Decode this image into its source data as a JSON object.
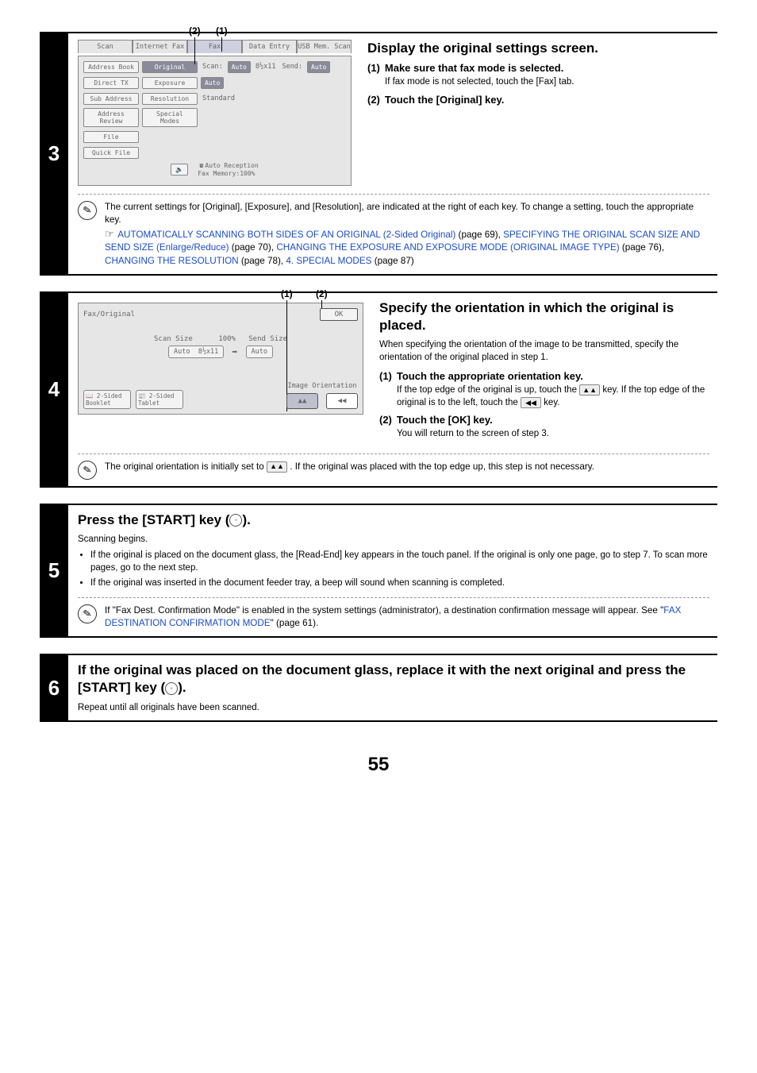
{
  "step3": {
    "num": "3",
    "anno1": "(2)",
    "anno2": "(1)",
    "tabs": {
      "scan": "Scan",
      "ifax": "Internet Fax",
      "fax": "Fax",
      "dataentry": "Data Entry",
      "usb": "USB Mem. Scan"
    },
    "left": {
      "addrbook": "Address Book",
      "directtx": "Direct TX",
      "subaddr": "Sub Address",
      "addrrev": "Address Review",
      "file": "File",
      "quick": "Quick File"
    },
    "mid": {
      "original": "Original",
      "exposure": "Exposure",
      "resolution": "Resolution",
      "special": "Special Modes"
    },
    "right": {
      "scanlbl": "Scan:",
      "auto": "Auto",
      "size": "8½x11",
      "sendlbl": "Send:",
      "auto2": "Auto",
      "expauto": "Auto",
      "resstd": "Standard"
    },
    "footer": {
      "autorec": "Auto Reception",
      "mem": "Fax Memory:100%",
      "phone": "☎"
    },
    "heading": "Display the original settings screen.",
    "item1_num": "(1)",
    "item1_bold": "Make sure that fax mode is selected.",
    "item1_desc": "If fax mode is not selected, touch the [Fax] tab.",
    "item2_num": "(2)",
    "item2_bold": "Touch the [Original] key.",
    "note_lead": "The current settings for [Original], [Exposure], and [Resolution], are indicated at the right of each key. To change a setting, touch the appropriate key.",
    "note_pointer": "☞",
    "note_link1": "AUTOMATICALLY SCANNING BOTH SIDES OF AN ORIGINAL (2-Sided Original)",
    "note_p1": " (page 69), ",
    "note_link2": "SPECIFYING THE ORIGINAL SCAN SIZE AND SEND SIZE (Enlarge/Reduce)",
    "note_p2": " (page 70), ",
    "note_link3": "CHANGING THE EXPOSURE AND EXPOSURE MODE (ORIGINAL IMAGE TYPE)",
    "note_p3": " (page 76), ",
    "note_link4": "CHANGING THE RESOLUTION",
    "note_p4": " (page 78), ",
    "note_link5": "4. SPECIAL MODES",
    "note_p5": " (page 87)"
  },
  "step4": {
    "num": "4",
    "anno1": "(1)",
    "anno2": "(2)",
    "panel": {
      "title": "Fax/Original",
      "ok": "OK",
      "scansize": "Scan Size",
      "pct": "100%",
      "sendsize": "Send Size",
      "auto": "Auto",
      "size": "8½x11",
      "arrow": "➡",
      "auto2": "Auto",
      "book": "2-Sided\nBooklet",
      "tablet": "2-Sided\nTablet",
      "orientlbl": "Image Orientation",
      "top": "▲▲",
      "left": "◀◀"
    },
    "heading": "Specify the orientation in which the original is placed.",
    "lead": "When specifying the orientation of the image to be transmitted, specify the orientation of the original placed in step 1.",
    "item1_num": "(1)",
    "item1_bold": "Touch the appropriate orientation key.",
    "item1_desc_a": "If the top edge of the original is up, touch the ",
    "item1_desc_b": " key. If the top edge of the original is to the left, touch the ",
    "item1_desc_c": " key.",
    "item2_num": "(2)",
    "item2_bold": "Touch the [OK] key.",
    "item2_desc": "You will return to the screen of step 3.",
    "note_a": "The original orientation is initially set to ",
    "note_b": " . If the original was placed with the top edge up, this step is not necessary."
  },
  "step5": {
    "num": "5",
    "heading_a": "Press the [START] key (",
    "heading_b": ").",
    "lead": "Scanning begins.",
    "b1": "If the original is placed on the document glass, the [Read-End] key appears in the touch panel. If the original is only one page, go to step 7. To scan more pages, go to the next step.",
    "b2": "If the original was inserted in the document feeder tray, a beep will sound when scanning is completed.",
    "note_a": "If \"Fax Dest. Confirmation Mode\" is enabled in the system settings (administrator), a destination confirmation message will appear. See \"",
    "note_link": "FAX DESTINATION CONFIRMATION MODE",
    "note_b": "\" (page 61)."
  },
  "step6": {
    "num": "6",
    "heading_a": "If the original was placed on the document glass, replace it with the next original and press the [START] key (",
    "heading_b": ").",
    "desc": "Repeat until all originals have been scanned."
  },
  "page_number": "55"
}
